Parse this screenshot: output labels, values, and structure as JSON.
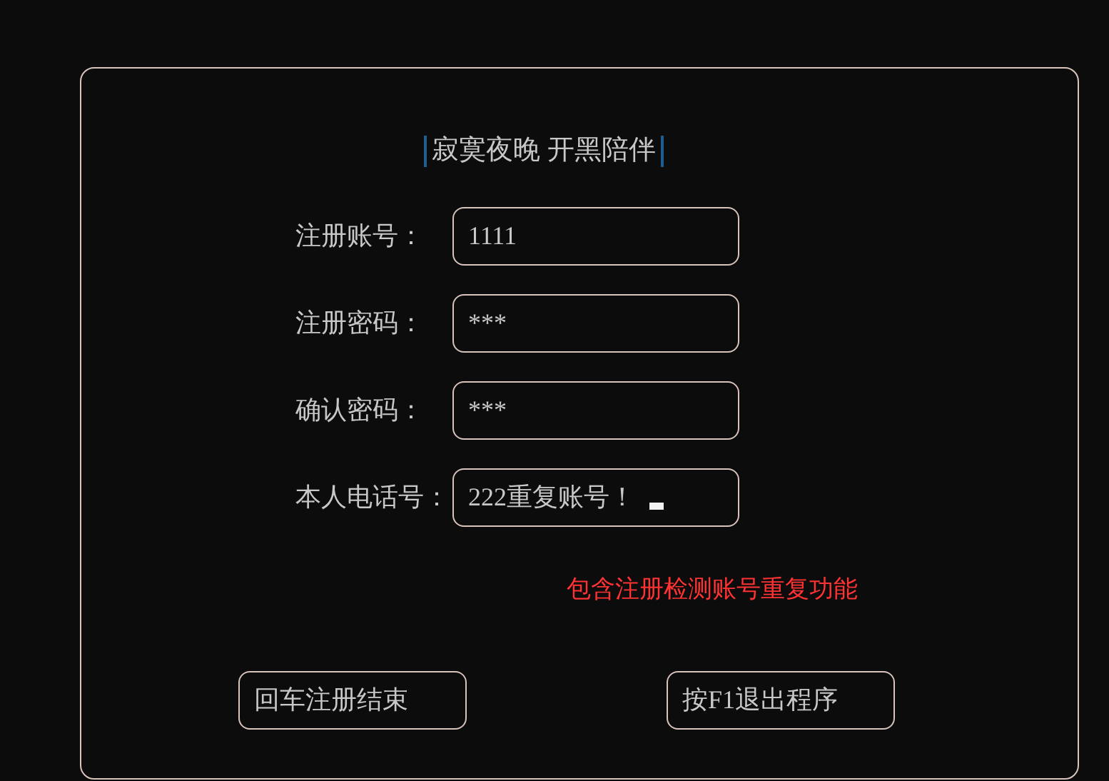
{
  "title": "寂寞夜晚 开黑陪伴",
  "fields": [
    {
      "label": "注册账号：",
      "value": "1111",
      "focused": false
    },
    {
      "label": "注册密码：",
      "value": "***",
      "focused": false
    },
    {
      "label": "确认密码：",
      "value": "***",
      "focused": false
    },
    {
      "label": "本人电话号：",
      "value": "222重复账号！",
      "focused": true
    }
  ],
  "note": "包含注册检测账号重复功能",
  "buttons": [
    "回车注册结束",
    "按F1退出程序"
  ]
}
